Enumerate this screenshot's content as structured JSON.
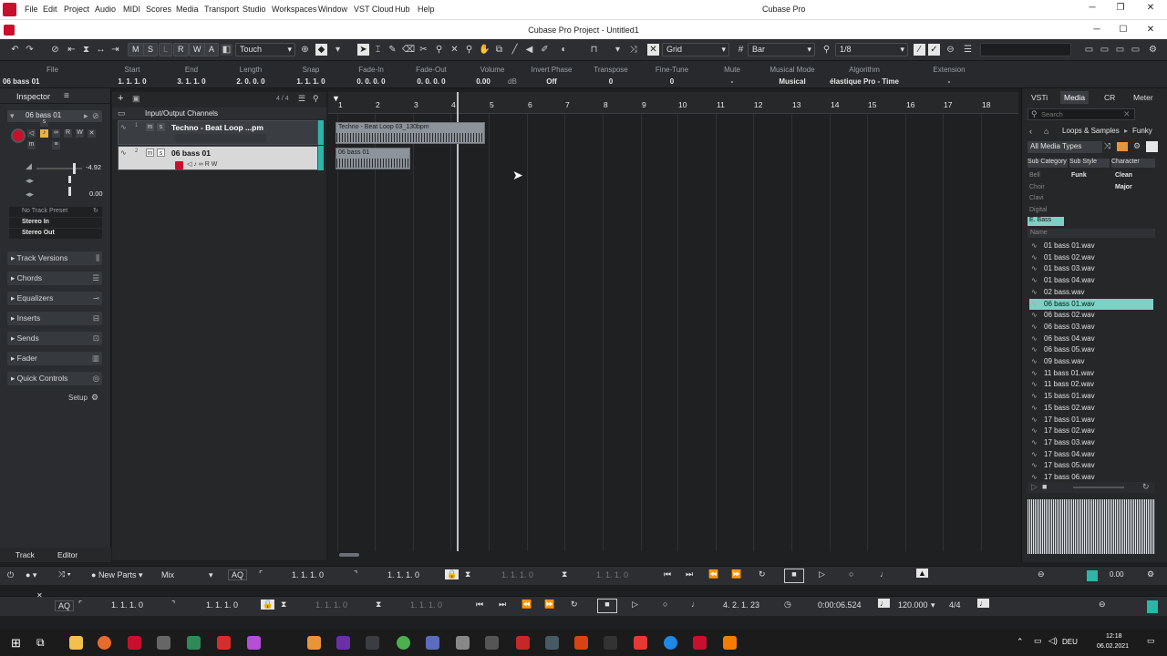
{
  "app": {
    "name": "Cubase Pro",
    "project_title": "Cubase Pro Project - Untitled1"
  },
  "menus": [
    "File",
    "Edit",
    "Project",
    "Audio",
    "MIDI",
    "Scores",
    "Media",
    "Transport",
    "Studio",
    "Workspaces",
    "Window",
    "VST Cloud",
    "Hub",
    "Help"
  ],
  "toolbar": {
    "m": "M",
    "s": "S",
    "l": "L",
    "r": "R",
    "w": "W",
    "a": "A",
    "automation_mode": "Touch",
    "snap_type": "Grid",
    "grid_type": "Bar",
    "quantize": "1/8"
  },
  "infoline": {
    "track_name": "06 bass 01",
    "fields": [
      {
        "h": "File",
        "v": ""
      },
      {
        "h": "Start",
        "v": "1. 1. 1. 0"
      },
      {
        "h": "End",
        "v": "3. 1. 1. 0"
      },
      {
        "h": "Length",
        "v": "2. 0. 0. 0"
      },
      {
        "h": "Snap",
        "v": "1. 1. 1. 0"
      },
      {
        "h": "Fade-In",
        "v": "0. 0. 0. 0"
      },
      {
        "h": "Fade-Out",
        "v": "0. 0. 0. 0"
      },
      {
        "h": "Volume",
        "v": "0.00"
      },
      {
        "h": "Invert Phase",
        "v": "Off"
      },
      {
        "h": "Transpose",
        "v": "0"
      },
      {
        "h": "Fine-Tune",
        "v": "0"
      },
      {
        "h": "Mute",
        "v": "-"
      },
      {
        "h": "Musical Mode",
        "v": "Musical"
      },
      {
        "h": "Algorithm",
        "v": "élastique Pro - Time"
      },
      {
        "h": "Extension",
        "v": "-"
      }
    ],
    "volume_unit": "dB"
  },
  "inspector": {
    "title": "Inspector",
    "track": "06 bass 01",
    "volume": "-4.92",
    "pan": "0.00",
    "preset": "No Track Preset",
    "input": "Stereo In",
    "output": "Stereo Out",
    "sections": [
      "Track Versions",
      "Chords",
      "Equalizers",
      "Inserts",
      "Sends",
      "Fader",
      "Quick Controls"
    ],
    "setup": "Setup",
    "tabs": [
      "Track",
      "Editor"
    ]
  },
  "tracks": {
    "count": "4 / 4",
    "folder": "Input/Output Channels",
    "items": [
      {
        "num": "1",
        "name": "Techno - Beat Loop ...pm"
      },
      {
        "num": "2",
        "name": "06 bass 01"
      }
    ]
  },
  "ruler": [
    "1",
    "2",
    "3",
    "4",
    "5",
    "6",
    "7",
    "8",
    "9",
    "10",
    "11",
    "12",
    "13",
    "14",
    "15",
    "16",
    "17",
    "18"
  ],
  "events": [
    {
      "name": "Techno - Beat Loop 03_130bpm"
    },
    {
      "name": "06 bass 01"
    }
  ],
  "mediabay": {
    "tabs": [
      "VSTi",
      "Media",
      "CR",
      "Meter"
    ],
    "search_placeholder": "Search",
    "path": [
      "Loops & Samples",
      "Funky"
    ],
    "filter": "All Media Types",
    "columns": [
      "Sub Category",
      "Sub Style",
      "Character"
    ],
    "categories": [
      "Bell",
      "Choir",
      "Clavi",
      "Digital",
      "E. Bass"
    ],
    "substyle": "Funk",
    "characters": [
      "Clean",
      "Major"
    ],
    "name_header": "Name",
    "selected_index": 5,
    "files": [
      "01 bass 01.wav",
      "01 bass 02.wav",
      "01 bass 03.wav",
      "01 bass 04.wav",
      "02 bass.wav",
      "06 bass 01.wav",
      "06 bass 02.wav",
      "06 bass 03.wav",
      "06 bass 04.wav",
      "06 bass 05.wav",
      "09 bass.wav",
      "11 bass 01.wav",
      "11 bass 02.wav",
      "15 bass 01.wav",
      "15 bass 02.wav",
      "17 bass 01.wav",
      "17 bass 02.wav",
      "17 bass 03.wav",
      "17 bass 04.wav",
      "17 bass 05.wav",
      "17 bass 06.wav"
    ]
  },
  "lower": {
    "new_parts": "New Parts",
    "mix": "Mix",
    "aq": "AQ",
    "pos1": "1. 1. 1. 0",
    "pos2": "1. 1. 1. 0",
    "pos3": "1. 1. 1. 0",
    "pos4": "1. 1. 1. 0"
  },
  "transport": {
    "aq": "AQ",
    "left": "1. 1. 1. 0",
    "right": "1. 1. 1. 0",
    "punch_in": "1. 1. 1. 0",
    "punch_out": "1. 1. 1. 0",
    "position": "4. 2. 1. 23",
    "time": "0:00:06.524",
    "tempo": "120.000",
    "signature": "4/4",
    "level": "0.00"
  },
  "taskbar": {
    "lang": "DEU",
    "time": "12:18",
    "date": "06.02.2021"
  },
  "colors": {
    "accent": "#c8102e",
    "teal": "#7fd0c4",
    "event": "#9aa0a8"
  }
}
